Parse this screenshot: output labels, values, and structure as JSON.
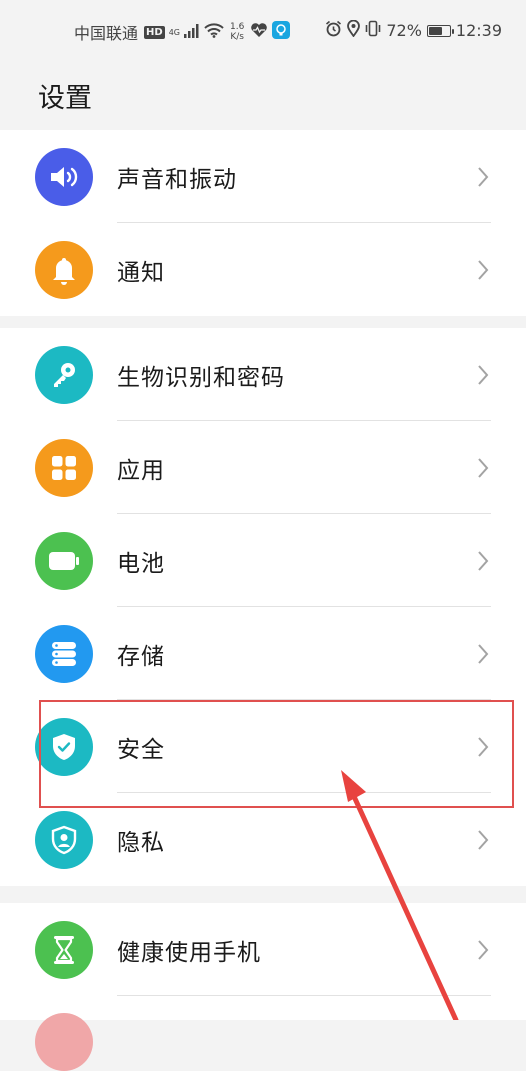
{
  "status_bar": {
    "carrier": "中国联通",
    "hd": "HD",
    "network": "4G",
    "speed_value": "1.6",
    "speed_unit": "K/s",
    "battery_percent": "72%",
    "battery_level": 0.72,
    "time": "12:39"
  },
  "page_title": "设置",
  "groups": [
    {
      "items": [
        {
          "label": "声音和振动",
          "icon": "volume-icon",
          "color": "#4a5de8"
        },
        {
          "label": "通知",
          "icon": "bell-icon",
          "color": "#f59a1c"
        }
      ]
    },
    {
      "items": [
        {
          "label": "生物识别和密码",
          "icon": "key-icon",
          "color": "#1cb9c3"
        },
        {
          "label": "应用",
          "icon": "apps-grid-icon",
          "color": "#f59a1c"
        },
        {
          "label": "电池",
          "icon": "battery-icon",
          "color": "#4cc150"
        },
        {
          "label": "存储",
          "icon": "storage-icon",
          "color": "#2299f0"
        },
        {
          "label": "安全",
          "icon": "shield-check-icon",
          "color": "#1cb9c3"
        },
        {
          "label": "隐私",
          "icon": "privacy-shield-icon",
          "color": "#1cb9c3"
        }
      ]
    },
    {
      "items": [
        {
          "label": "健康使用手机",
          "icon": "hourglass-icon",
          "color": "#4cc150"
        }
      ]
    }
  ],
  "annotation": {
    "highlight_color": "#e0504f",
    "arrow_color": "#e8433f"
  }
}
